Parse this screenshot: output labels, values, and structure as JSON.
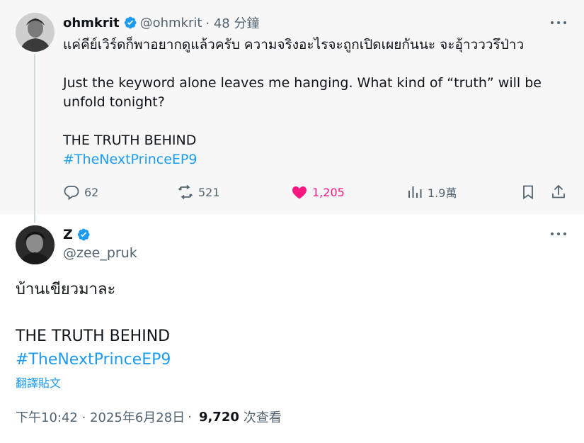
{
  "parent_tweet": {
    "display_name": "ohmkrit",
    "handle": "@ohmkrit",
    "time": "· 48 分鐘",
    "verified": true,
    "text_thai": "แค่คีย์เวิร์ดก็พาอยากดูแล้วครับ ความจริงอะไรจะถูกเปิดเผยกันนะ จะอุ้าวววรึป่าว",
    "text_en_line1": "Just the keyword alone leaves me hanging. What kind of “truth” will be",
    "text_en_line2": "unfold tonight?",
    "text_caps": "THE TRUTH BEHIND",
    "hashtag": "#TheNextPrinceEP9",
    "stats": {
      "replies": "62",
      "reposts": "521",
      "likes": "1,205",
      "views": "1.9萬"
    }
  },
  "focused_tweet": {
    "display_name": "Z",
    "handle": "@zee_pruk",
    "verified": true,
    "text_thai": "บ้านเขียวมาละ",
    "text_caps": "THE TRUTH BEHIND",
    "hashtag": "#TheNextPrinceEP9",
    "translate_label": "翻譯貼文",
    "timestamp": "下午10:42 · 2025年6月28日",
    "separator": "·",
    "view_count": "9,720",
    "view_label": "次查看"
  },
  "colors": {
    "accent": "#1d9bf0",
    "like": "#f91880",
    "muted": "#536471",
    "parent_bg": "#f7f7f7"
  },
  "icons": [
    "verified-badge-icon",
    "more-icon",
    "reply-icon",
    "repost-icon",
    "like-icon",
    "views-icon",
    "bookmark-icon",
    "share-icon"
  ]
}
